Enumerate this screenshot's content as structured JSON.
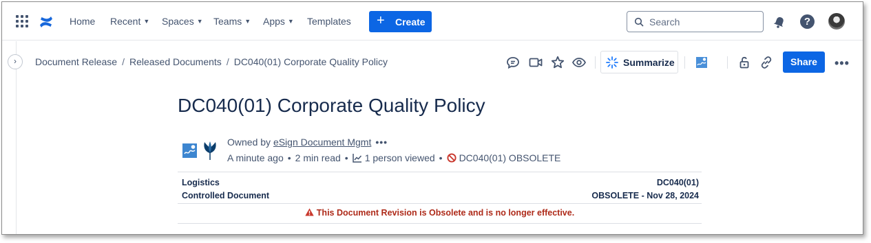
{
  "nav": {
    "items": [
      {
        "label": "Home",
        "dropdown": false
      },
      {
        "label": "Recent",
        "dropdown": true
      },
      {
        "label": "Spaces",
        "dropdown": true
      },
      {
        "label": "Teams",
        "dropdown": true
      },
      {
        "label": "Apps",
        "dropdown": true
      },
      {
        "label": "Templates",
        "dropdown": false
      }
    ],
    "create_label": "Create",
    "search_placeholder": "Search",
    "help_glyph": "?",
    "icons": [
      "app-switcher-icon",
      "confluence-logo-icon",
      "search-icon",
      "notifications-icon",
      "help-icon",
      "avatar"
    ]
  },
  "breadcrumb": {
    "items": [
      "Document Release",
      "Released Documents",
      "DC040(01) Corporate Quality Policy"
    ],
    "separator": "/"
  },
  "toolbar": {
    "summarize_label": "Summarize",
    "share_label": "Share",
    "more_label": "•••",
    "icons": [
      "comment-icon",
      "video-icon",
      "star-icon",
      "watch-icon",
      "ai-sparkle-icon",
      "esign-app-icon",
      "restrictions-icon",
      "link-icon",
      "more-icon"
    ]
  },
  "page": {
    "title": "DC040(01) Corporate Quality Policy",
    "owned_by_prefix": "Owned by ",
    "owner": "eSign Document Mgmt",
    "owner_menu": "•••",
    "updated": "A minute ago",
    "read_time": "2 min read",
    "views": "1 person viewed",
    "status": "DC040(01) OBSOLETE"
  },
  "doc_header": {
    "category": "Logistics",
    "doc_type": "Controlled Document",
    "doc_id": "DC040(01)",
    "doc_state": "OBSOLETE - Nov 28, 2024",
    "warning": "This Document Revision is Obsolete and is no longer effective."
  },
  "colors": {
    "primary": "#0c66e4",
    "text": "#172b4d",
    "subtle": "#44546f",
    "danger": "#ae2a19",
    "obsolete_icon": "#c9372c"
  }
}
